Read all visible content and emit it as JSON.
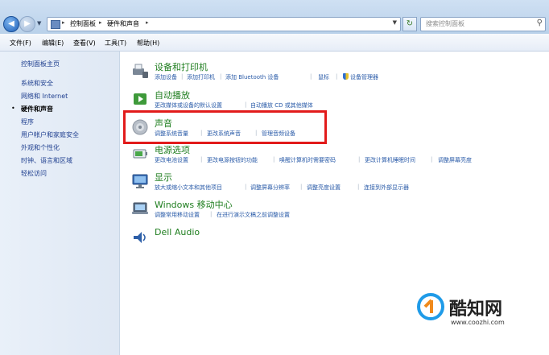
{
  "address_bar": {
    "breadcrumbs": [
      "控制面板",
      "硬件和声音"
    ],
    "search_placeholder": "搜索控制面板"
  },
  "menu": [
    "文件(F)",
    "编辑(E)",
    "查看(V)",
    "工具(T)",
    "帮助(H)"
  ],
  "left_pane": {
    "home": "控制面板主页",
    "items": [
      {
        "label": "系统和安全",
        "current": false
      },
      {
        "label": "网络和 Internet",
        "current": false
      },
      {
        "label": "硬件和声音",
        "current": true
      },
      {
        "label": "程序",
        "current": false
      },
      {
        "label": "用户帐户和家庭安全",
        "current": false
      },
      {
        "label": "外观和个性化",
        "current": false
      },
      {
        "label": "时钟、语言和区域",
        "current": false
      },
      {
        "label": "轻松访问",
        "current": false
      }
    ]
  },
  "categories": {
    "devices": {
      "title": "设备和打印机",
      "links": [
        "添加设备",
        "添加打印机",
        "添加 Bluetooth 设备",
        "鼠标",
        "设备管理器"
      ]
    },
    "autoplay": {
      "title": "自动播放",
      "links": [
        "更改媒体或设备的默认设置",
        "自动播放 CD 或其他媒体"
      ]
    },
    "sound": {
      "title": "声音",
      "links": [
        "调整系统音量",
        "更改系统声音",
        "管理音频设备"
      ]
    },
    "power": {
      "title": "电源选项",
      "links": [
        "更改电池设置",
        "更改电源按钮的功能",
        "唤醒计算机时需要密码",
        "更改计算机睡眠时间",
        "调整屏幕亮度"
      ]
    },
    "display": {
      "title": "显示",
      "links": [
        "放大或缩小文本和其他项目",
        "调整屏幕分辨率",
        "调整亮度设置",
        "连接到外部显示器"
      ]
    },
    "mobility": {
      "title": "Windows 移动中心",
      "links": [
        "调整常用移动设置",
        "在进行演示文稿之前调整设置"
      ]
    },
    "dell": {
      "title": "Dell Audio"
    }
  },
  "watermark": {
    "brand": "酷知网",
    "url": "www.coozhi.com"
  },
  "colors": {
    "highlight_box": "#e21b1b",
    "category_title": "#1f7e1f",
    "link": "#2a5ba8"
  }
}
